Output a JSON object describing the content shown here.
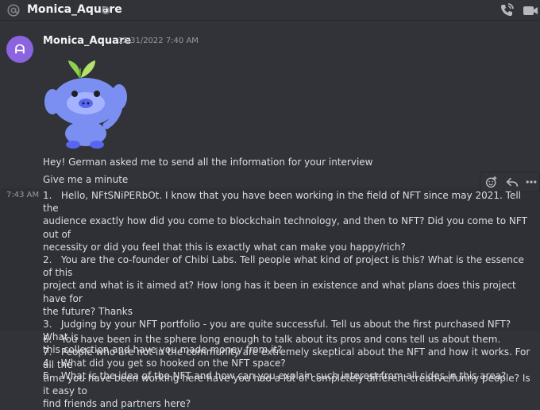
{
  "header": {
    "dm_name": "Monica_Aquare",
    "icons": [
      "at-icon",
      "status-idle-icon",
      "voice-call-icon",
      "video-call-icon"
    ]
  },
  "message": {
    "avatar_letters": "ᗩ",
    "author": "Monica_Aquare",
    "timestamp": "12/31/2022 7:40 AM",
    "sticker": "wumpus-sprout-sticker",
    "line1": "Hey! German asked me to send all the information for your interview",
    "line2": "Give me a minute"
  },
  "followup": {
    "side_time": "7:43 AM",
    "actions": [
      "add-reaction-icon",
      "reply-icon",
      "more-icon"
    ],
    "questions_a": [
      "1.   Hello, NFtSNiPERbOt. I know that you have been working in the field of NFT since may 2021. Tell the",
      "audience exactly how did you come to blockchain technology, and then to NFT? Did you come to NFT out of",
      "necessity or did you feel that this is exactly what can make you happy/rich?",
      "2.   You are the co-founder of Chibi Labs. Tell people what kind of project is this? What is the essence of this",
      "project and what is it aimed at? How long has it been in existence and what plans does this project have for",
      "the future? Thanks",
      "3.   Judging by your NFT portfolio - you are quite successful. Tell us about the first purchased NFT? What is",
      "this collection and have you made money from it?",
      "4.   What did you get so hooked on the NFT space?",
      "5.   What is the idea of the NFT and how can you explain such interest from all sides in this area?"
    ],
    "questions_b": [
      "6.   You have been in the sphere long enough to talk about its pros and cons tell us about them.",
      "7.   People who are not in the community are extremely skeptical about the NFT and how it works. For all the",
      "time you have been working here have you had a lot of completely different creative/funny people? Is it easy to",
      "find friends and partners here?"
    ]
  },
  "colors": {
    "background": "#313338",
    "hover_background": "#2e3035",
    "avatar": "#8c64e0",
    "wumpus": "#7b8ff2",
    "leaf": "#8fd14f"
  }
}
